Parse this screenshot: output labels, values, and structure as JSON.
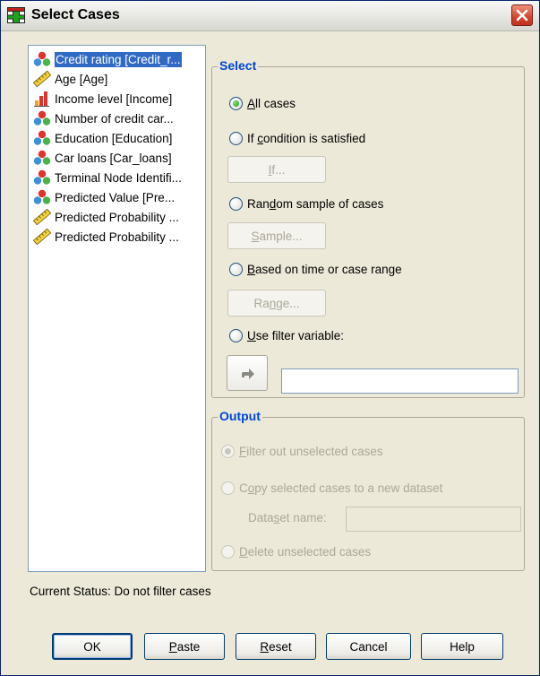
{
  "window": {
    "title": "Select Cases"
  },
  "variables": [
    {
      "label": "Credit rating [Credit_r...",
      "icon": "nominal-icon",
      "selected": true
    },
    {
      "label": "Age [Age]",
      "icon": "scale-icon"
    },
    {
      "label": "Income level [Income]",
      "icon": "ordinal-icon"
    },
    {
      "label": "Number of credit car...",
      "icon": "nominal-icon"
    },
    {
      "label": "Education [Education]",
      "icon": "nominal-icon"
    },
    {
      "label": "Car loans [Car_loans]",
      "icon": "nominal-icon"
    },
    {
      "label": "Terminal Node Identifi...",
      "icon": "nominal-icon"
    },
    {
      "label": "Predicted Value [Pre...",
      "icon": "nominal-icon"
    },
    {
      "label": "Predicted Probability ...",
      "icon": "scale-icon"
    },
    {
      "label": "Predicted Probability ...",
      "icon": "scale-icon"
    }
  ],
  "select": {
    "legend": "Select",
    "all_cases": {
      "pre": "",
      "key": "A",
      "post": "ll cases"
    },
    "if_condition": {
      "pre": "If ",
      "key": "c",
      "post": "ondition is satisfied"
    },
    "if_button": {
      "pre": "",
      "key": "I",
      "post": "f..."
    },
    "random_sample": {
      "pre": "Ran",
      "key": "d",
      "post": "om sample of cases"
    },
    "sample_button": {
      "pre": "",
      "key": "S",
      "post": "ample..."
    },
    "based_on_time": {
      "pre": "",
      "key": "B",
      "post": "ased on time or case range"
    },
    "range_button": {
      "pre": "Ra",
      "key": "n",
      "post": "ge..."
    },
    "use_filter": {
      "pre": "",
      "key": "U",
      "post": "se filter variable:"
    },
    "filter_variable_value": ""
  },
  "output": {
    "legend": "Output",
    "filter_out": {
      "pre": "",
      "key": "F",
      "post": "ilter out unselected cases"
    },
    "copy_selected": {
      "pre": "C",
      "key": "o",
      "post": "py selected cases to a new dataset"
    },
    "dataset_name_label": {
      "pre": "Data",
      "key": "s",
      "post": "et name:"
    },
    "dataset_name_value": "",
    "delete_unselected": {
      "pre": "",
      "key": "D",
      "post": "elete unselected cases"
    }
  },
  "status": "Current Status: Do not filter cases",
  "buttons": {
    "ok": {
      "pre": "OK",
      "key": "",
      "post": ""
    },
    "paste": {
      "pre": "",
      "key": "P",
      "post": "aste"
    },
    "reset": {
      "pre": "",
      "key": "R",
      "post": "eset"
    },
    "cancel": {
      "pre": "Cancel",
      "key": "",
      "post": ""
    },
    "help": {
      "pre": "Help",
      "key": "",
      "post": ""
    }
  },
  "colors": {
    "accent": "#0046d5",
    "selection": "#316ac5",
    "dialog_bg": "#ece9d8",
    "close_button": "#d4452c"
  }
}
